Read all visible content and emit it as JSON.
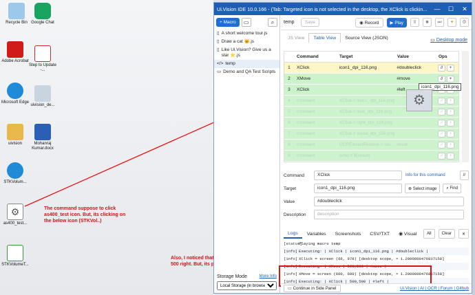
{
  "desktop": {
    "icons": [
      {
        "label": "Recycle Bin",
        "color": "#7ab7e8"
      },
      {
        "label": "Google Chat",
        "color": "#1aa260"
      },
      {
        "label": "Adobe Acrobat",
        "color": "#d11b1b"
      },
      {
        "label": "Step to Update -...",
        "color": "#cc2b2b"
      },
      {
        "label": "Microsoft Edge",
        "color": "#1e8ad8"
      },
      {
        "label": "uivision_de...",
        "color": "#6b8fb0"
      },
      {
        "label": "uivision",
        "color": "#e8b84a"
      },
      {
        "label": "Mohanraj Kumar.docx",
        "color": "#2b5fb3"
      },
      {
        "label": "STKVolum...",
        "color": "#1e8ad8"
      },
      {
        "label": "as400_test...",
        "color": "#555555"
      },
      {
        "label": "STKVolumeT...",
        "color": "#2e9a3a"
      }
    ],
    "annotation_click": "The command suppose to click as400_test icon. But, its clicking on the below icon (STKVol..)",
    "annotation_xmove": "Also, I noticed that the XMove should print 500, 500 right. But, its printing 600, 600. Why?"
  },
  "window": {
    "title": "Ui.Vision IDE 10.0.166 - (Tab: Targeted icon is not selected in the desktop, the XClick is clickin...",
    "min": "—",
    "max": "☐",
    "close": "✕"
  },
  "sidebar": {
    "new_macro": "+ Macro",
    "macros": [
      "A short welcome tour.js",
      "Draw a cat 🐱.js",
      "Like Ui.Vision? Give us a star ⭐.js",
      "temp",
      "Demo and QA Test Scripts"
    ],
    "storage_title": "Storage Mode",
    "more_info": "More Info",
    "storage_value": "Local Storage (in browser)"
  },
  "toolbar": {
    "macro_name": "temp",
    "save": "Save",
    "record": "Record",
    "play": "Play"
  },
  "tabs": {
    "js_view": "JS View",
    "table_view": "Table View",
    "source_view": "Source View (JSON)",
    "desktop_mode": "Desktop mode"
  },
  "table": {
    "headers": {
      "command": "Command",
      "target": "Target",
      "value": "Value",
      "ops": "Ops"
    },
    "rows": [
      {
        "n": "1",
        "cmd": "XClick",
        "tgt": "icon1_dpi_116.png",
        "val": "#doubleclick"
      },
      {
        "n": "2",
        "cmd": "XMove",
        "tgt": "",
        "val": "#move"
      },
      {
        "n": "3",
        "cmd": "XClick",
        "tgt": "",
        "val": "#left"
      },
      {
        "n": "4",
        "cmd": "comment",
        "tgt": "XClick // icon1_dpi_116.png",
        "val": ""
      },
      {
        "n": "5",
        "cmd": "comment",
        "tgt": "XClick // icon_dpi_116.png",
        "val": ""
      },
      {
        "n": "6",
        "cmd": "comment",
        "tgt": "XClick // right_dpi_116.png",
        "val": ""
      },
      {
        "n": "7",
        "cmd": "comment",
        "tgt": "XClick // equal_dpi_116.png",
        "val": ""
      },
      {
        "n": "8",
        "cmd": "comment",
        "tgt": "OCRExtractRelative // ocr...",
        "val": "result"
      },
      {
        "n": "9",
        "cmd": "comment",
        "tgt": "echo // ${result}",
        "val": ""
      }
    ],
    "tooltip": "icon1_dpi_116.png"
  },
  "form": {
    "command_label": "Command",
    "command_value": "XClick",
    "info_link": "Info for this command",
    "target_label": "Target",
    "target_value": "icon1_dpi_116.png",
    "select_image": "Select image",
    "find": "Find",
    "value_label": "Value",
    "value_value": "#doubleclick",
    "desc_label": "Description",
    "desc_placeholder": "description"
  },
  "logs": {
    "tabs": [
      "Logs",
      "Variables",
      "Screenshots",
      "CSV/TXT",
      "Visual"
    ],
    "filter": "All",
    "clear": "Clear",
    "lines": [
      {
        "lvl": "[status]",
        "text": "Playing macro temp"
      },
      {
        "lvl": "[info]",
        "text": "Executing:  | XClick | icon1_dpi_116.png | #doubleclick |"
      },
      {
        "lvl": "[info]",
        "text": "XClick = screen (66, 978) [desktop scope, × 1.2000000476837158]"
      },
      {
        "lvl": "[info]",
        "text": "Executing:  | XMove | 500,500 | #move |"
      },
      {
        "lvl": "[info]",
        "text": "XMove = screen (600, 600) [desktop scope, × 1.2000000476837158]"
      },
      {
        "lvl": "[info]",
        "text": "Executing:  | XClick | 500,500 | #left |"
      }
    ]
  },
  "bottom": {
    "continue_side_panel": "Continue in Side Panel",
    "links": "Ui.Vision | AI | OCR | Forum | Github"
  }
}
